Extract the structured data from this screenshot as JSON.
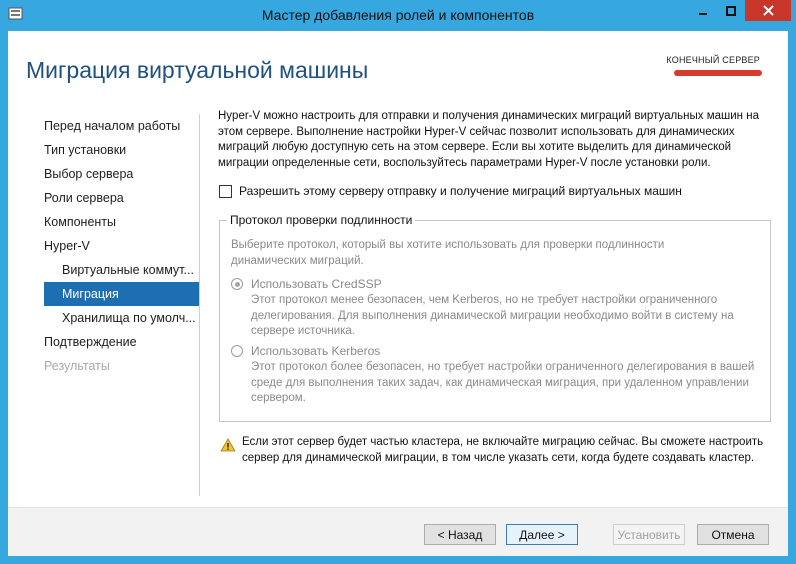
{
  "window": {
    "title": "Мастер добавления ролей и компонентов"
  },
  "header": {
    "page_title": "Миграция виртуальной машины",
    "destination_label": "КОНЕЧНЫЙ СЕРВЕР"
  },
  "sidebar": {
    "items": [
      {
        "label": "Перед началом работы"
      },
      {
        "label": "Тип установки"
      },
      {
        "label": "Выбор сервера"
      },
      {
        "label": "Роли сервера"
      },
      {
        "label": "Компоненты"
      },
      {
        "label": "Hyper-V"
      },
      {
        "label": "Виртуальные коммут..."
      },
      {
        "label": "Миграция"
      },
      {
        "label": "Хранилища по умолч..."
      },
      {
        "label": "Подтверждение"
      },
      {
        "label": "Результаты"
      }
    ]
  },
  "content": {
    "intro": "Hyper-V можно настроить для отправки и получения динамических миграций виртуальных машин на этом сервере. Выполнение настройки Hyper-V сейчас позволит использовать для динамических миграций любую доступную сеть на этом сервере. Если вы хотите выделить для динамической миграции определенные сети, воспользуйтесь параметрами Hyper-V после установки роли.",
    "allow_checkbox_label": "Разрешить этому серверу отправку и получение миграций виртуальных машин",
    "auth_group": {
      "legend": "Протокол проверки подлинности",
      "description": "Выберите протокол, который вы хотите использовать для проверки подлинности динамических миграций.",
      "credssp_label": "Использовать CredSSP",
      "credssp_desc": "Этот протокол менее безопасен, чем Kerberos, но не требует настройки ограниченного делегирования. Для выполнения динамической миграции необходимо войти в систему на сервере источника.",
      "kerberos_label": "Использовать Kerberos",
      "kerberos_desc": "Этот протокол более безопасен, но требует настройки ограниченного делегирования в вашей среде для выполнения таких задач, как динамическая миграция, при удаленном управлении сервером."
    },
    "warning": "Если этот сервер будет частью кластера, не включайте миграцию сейчас. Вы сможете настроить сервер для динамической миграции, в том числе указать сети, когда будете создавать кластер."
  },
  "footer": {
    "back_label": "< Назад",
    "next_label": "Далее >",
    "install_label": "Установить",
    "cancel_label": "Отмена"
  },
  "colors": {
    "title_bar": "#37a7df",
    "accent": "#1e6fb2",
    "heading": "#1e5180",
    "close_button": "#c7352b"
  }
}
